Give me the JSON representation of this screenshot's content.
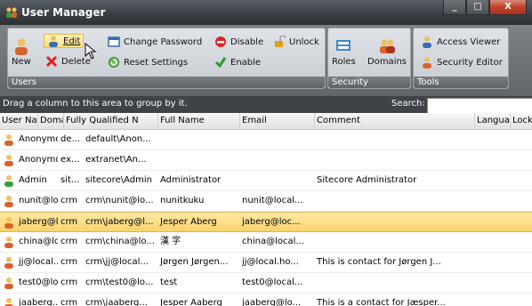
{
  "window": {
    "title": "User Manager",
    "controls": [
      "_",
      "□",
      "X"
    ]
  },
  "ribbon": {
    "users_group": {
      "label": "Users",
      "new": "New",
      "edit": "Edit",
      "delete": "Delete",
      "change_password": "Change Password",
      "reset_settings": "Reset Settings",
      "disable": "Disable",
      "enable": "Enable",
      "unlock": "Unlock"
    },
    "security_group": {
      "label": "Security",
      "roles": "Roles",
      "domains": "Domains"
    },
    "tools_group": {
      "label": "Tools",
      "access_viewer": "Access Viewer",
      "security_editor": "Security Editor"
    }
  },
  "grid": {
    "group_hint": "Drag a column to this area to group by it.",
    "search_label": "Search:",
    "search_value": "",
    "columns": [
      "User Name",
      "Doma",
      "Fully Qualified N",
      "Full Name",
      "Email",
      "Comment",
      "Langua",
      "Lock"
    ],
    "rows": [
      {
        "user": "Anonymous",
        "domain": "de...",
        "fqn": "default\\Anon...",
        "full": "",
        "email": "",
        "comment": "",
        "selected": false
      },
      {
        "user": "Anonymous",
        "domain": "ex...",
        "fqn": "extranet\\An...",
        "full": "",
        "email": "",
        "comment": "",
        "selected": false
      },
      {
        "user": "Admin",
        "domain": "sit...",
        "fqn": "sitecore\\Admin",
        "full": "Administrator",
        "email": "",
        "comment": "Sitecore Administrator",
        "selected": false
      },
      {
        "user": "nunit@lo...",
        "domain": "crm",
        "fqn": "crm\\nunit@lo...",
        "full": "nunitkuku",
        "email": "nunit@local...",
        "comment": "",
        "selected": false
      },
      {
        "user": "jaberg@l...",
        "domain": "crm",
        "fqn": "crm\\jaberg@l...",
        "full": "Jesper Aberg",
        "email": "jaberg@loc...",
        "comment": "",
        "selected": true
      },
      {
        "user": "china@lo...",
        "domain": "crm",
        "fqn": "crm\\china@lo...",
        "full": "漢 字",
        "email": "china@local...",
        "comment": "",
        "selected": false
      },
      {
        "user": "jj@local....",
        "domain": "crm",
        "fqn": "crm\\jj@local...",
        "full": "Jørgen Jørgen...",
        "email": "jj@local.ho...",
        "comment": "This is contact for Jørgen J...",
        "selected": false
      },
      {
        "user": "test0@lo...",
        "domain": "crm",
        "fqn": "crm\\test0@lo...",
        "full": "test",
        "email": "test0@local...",
        "comment": "",
        "selected": false
      },
      {
        "user": "jaaberg...",
        "domain": "crm",
        "fqn": "crm\\jaaberg...",
        "full": "Jesper Aaberg",
        "email": "jaaberg@lo...",
        "comment": "This is a contact for Jæsper...",
        "selected": false
      }
    ]
  },
  "colors": {
    "accent": "#fcd36b",
    "dark": "#3f4348",
    "user_icon": "#d9622b"
  }
}
